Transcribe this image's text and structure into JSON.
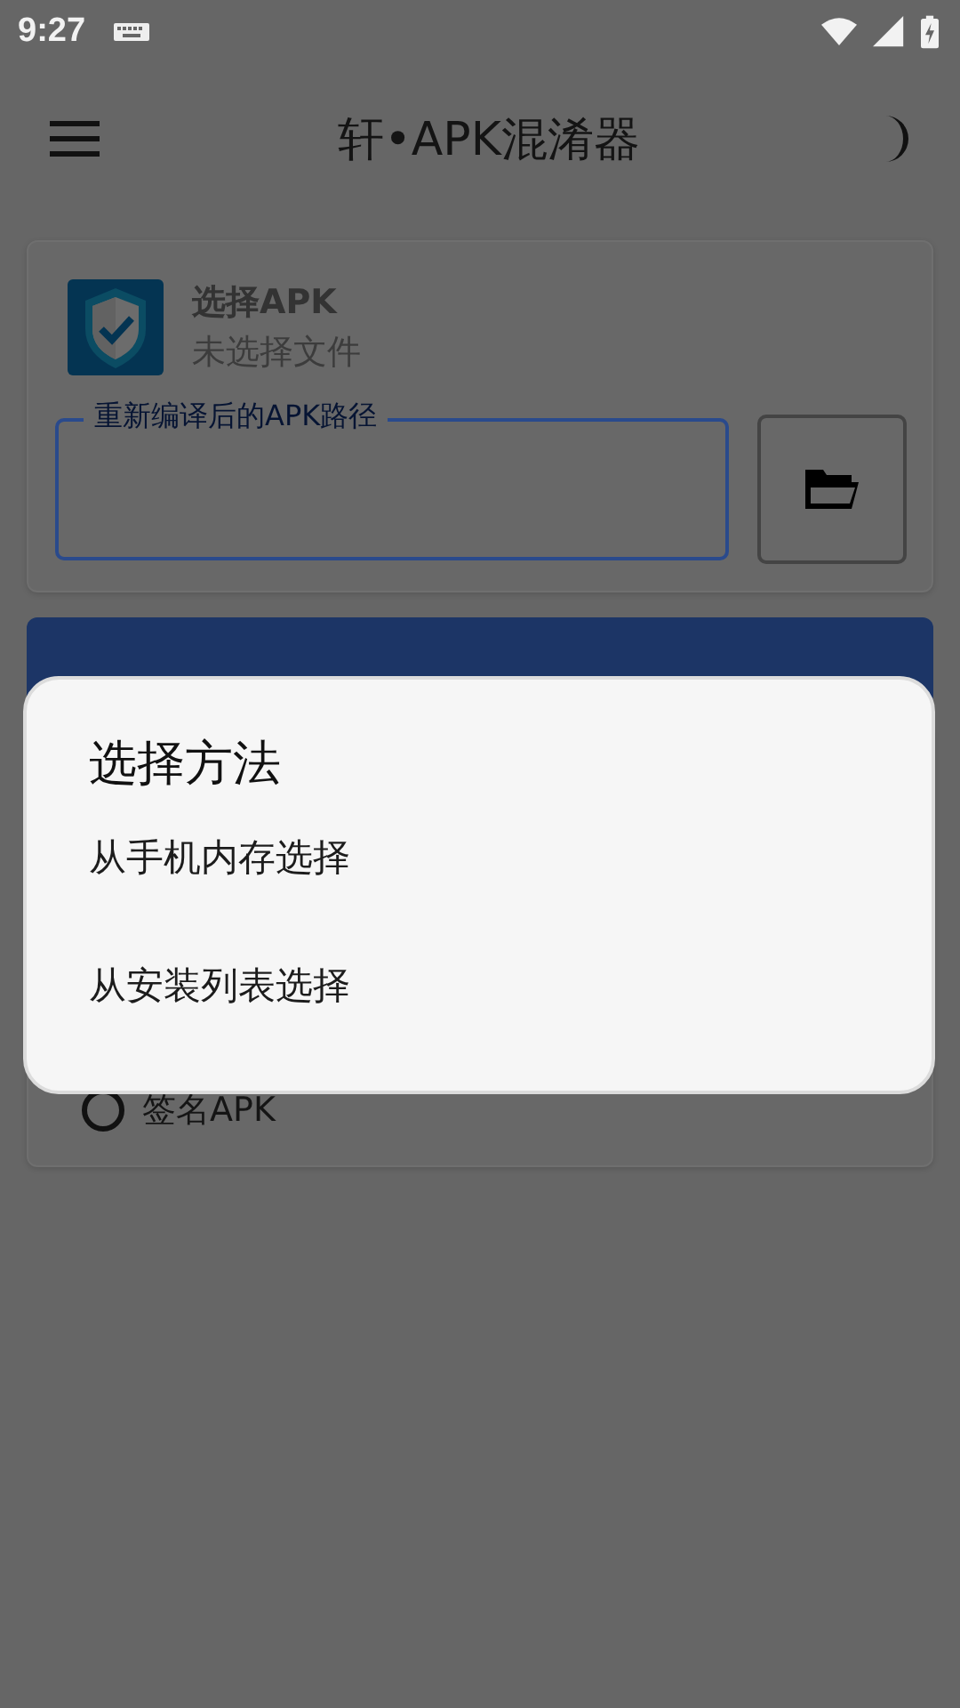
{
  "status_bar": {
    "time": "9:27"
  },
  "app_bar": {
    "title": "轩•APK混淆器"
  },
  "select_card": {
    "title": "选择APK",
    "subtitle": "未选择文件",
    "path_field": {
      "label": "重新编译后的APK路径"
    }
  },
  "options": [
    {
      "label": "签名APK",
      "checked": false
    }
  ],
  "dialog": {
    "title": "选择方法",
    "items": [
      "从手机内存选择",
      "从安装列表选择"
    ]
  }
}
